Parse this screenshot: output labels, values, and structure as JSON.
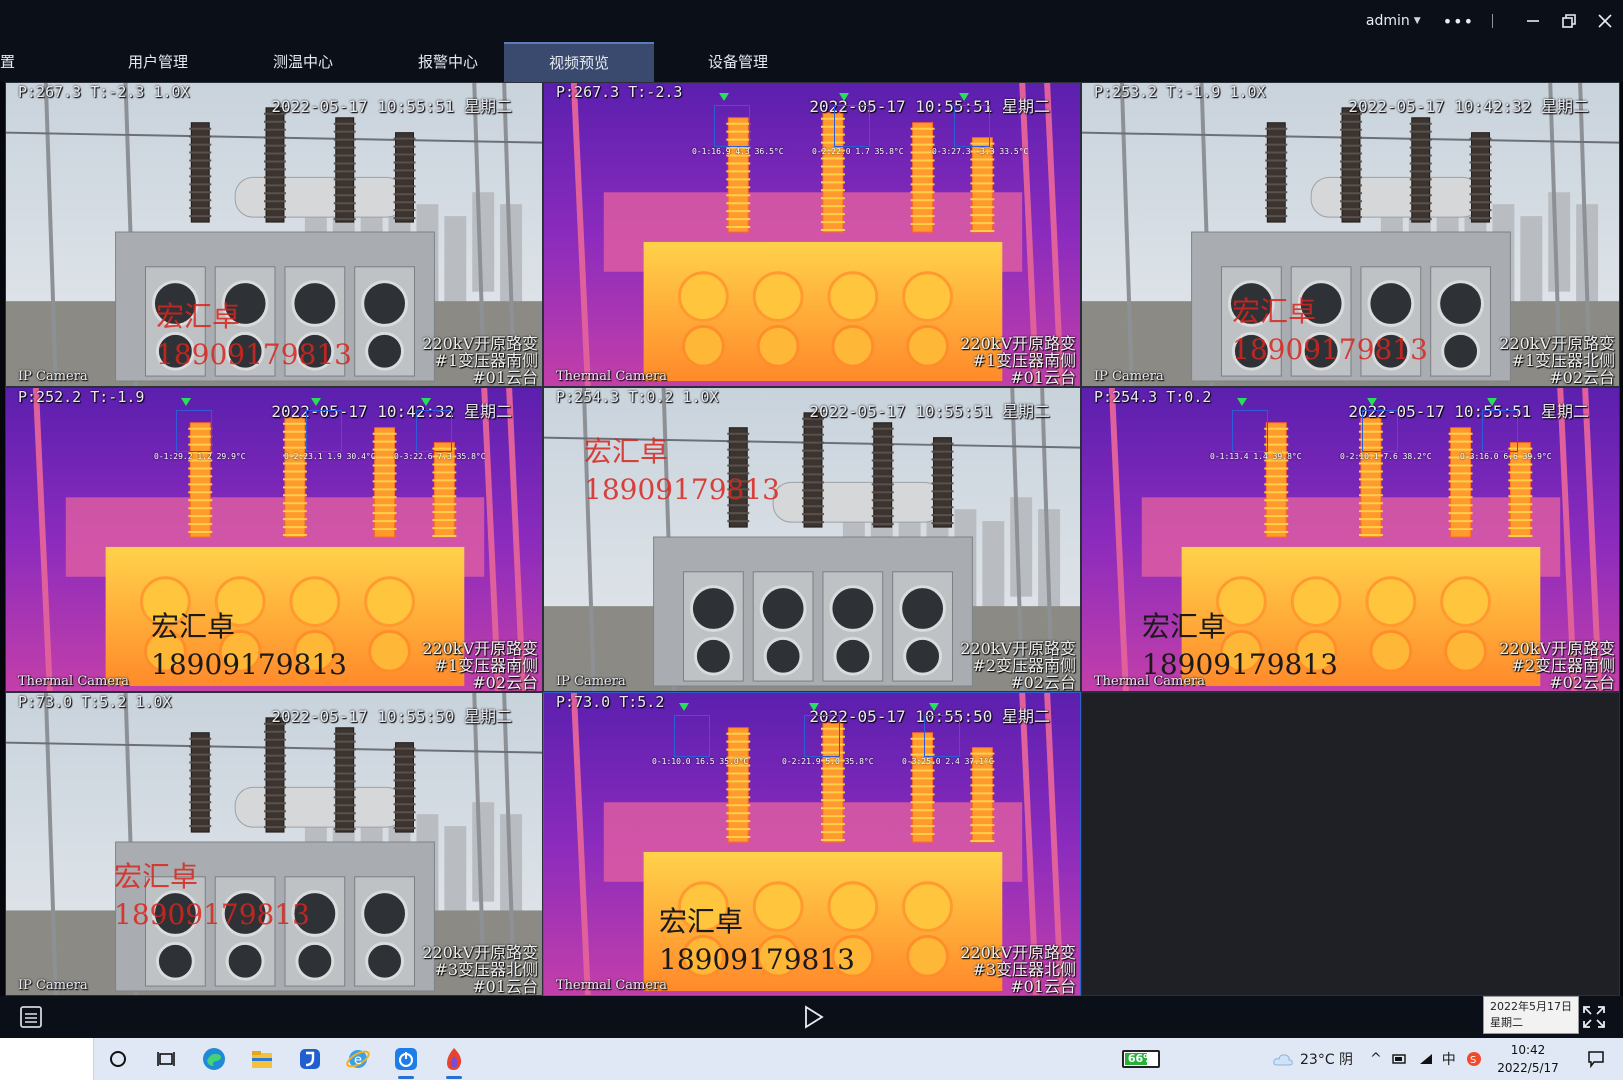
{
  "window": {
    "user": "admin",
    "more_label": "•••",
    "colors": {
      "titlebar": "#0b0f17",
      "active_tab": "#3a4a6e",
      "selected_border": "#2e62c8"
    }
  },
  "nav": {
    "items": [
      {
        "label": "置",
        "active": false
      },
      {
        "label": "用户管理",
        "active": false
      },
      {
        "label": "测温中心",
        "active": false
      },
      {
        "label": "报警中心",
        "active": false
      },
      {
        "label": "视频预览",
        "active": true
      },
      {
        "label": "设备管理",
        "active": false
      }
    ]
  },
  "cells": [
    {
      "type": "visible",
      "ptz": "P:267.3 T:-2.3 1.0X",
      "time": "2022-05-17 10:55:51 星期二",
      "camera": "IP Camera",
      "location": [
        "220kV开原路变",
        "#1变压器南侧",
        "#01云台"
      ],
      "watermark": [
        "宏汇卓",
        "18909179813"
      ],
      "watermark_color": "red"
    },
    {
      "type": "thermal",
      "ptz": "P:267.3 T:-2.3",
      "time": "2022-05-17 10:55:51 星期二",
      "camera": "Thermal Camera",
      "location": [
        "220kV开原路变",
        "#1变压器南侧",
        "#01云台"
      ],
      "rois": [
        "0-1:16.9 4.3 36.5°C",
        "0-2:22.0 1.7 35.8°C",
        "0-3:27.3 -3.3 33.5°C"
      ]
    },
    {
      "type": "visible",
      "ptz": "P:253.2 T:-1.9 1.0X",
      "time": "2022-05-17 10:42:32 星期二",
      "camera": "IP Camera",
      "location": [
        "220kV开原路变",
        "#1变压器北侧",
        "#02云台"
      ],
      "watermark": [
        "宏汇卓",
        "18909179813"
      ],
      "watermark_color": "red"
    },
    {
      "type": "thermal",
      "ptz": "P:252.2 T:-1.9",
      "time": "2022-05-17 10:42:32 星期二",
      "camera": "Thermal Camera",
      "location": [
        "220kV开原路变",
        "#1变压器南侧",
        "#02云台"
      ],
      "rois": [
        "0-1:29.2 1.2 29.9°C",
        "0-2:23.1 1.9 30.4°C",
        "0-3:22.6 7.3 35.8°C"
      ],
      "watermark": [
        "宏汇卓",
        "18909179813"
      ],
      "watermark_color": "dark"
    },
    {
      "type": "visible",
      "ptz": "P:254.3 T:0.2 1.0X",
      "time": "2022-05-17 10:55:51 星期二",
      "camera": "IP Camera",
      "location": [
        "220kV开原路变",
        "#2变压器南侧",
        "#02云台"
      ],
      "watermark": [
        "宏汇卓",
        "18909179813"
      ],
      "watermark_color": "red"
    },
    {
      "type": "thermal",
      "ptz": "P:254.3 T:0.2",
      "time": "2022-05-17 10:55:51 星期二",
      "camera": "Thermal Camera",
      "location": [
        "220kV开原路变",
        "#2变压器南侧",
        "#02云台"
      ],
      "rois": [
        "0-1:13.4 1.4 39.8°C",
        "0-2:10.1 7.6 38.2°C",
        "0-3:16.0 6.6 39.9°C"
      ],
      "watermark": [
        "宏汇卓",
        "18909179813"
      ],
      "watermark_color": "dark"
    },
    {
      "type": "visible",
      "ptz": "P:73.0 T:5.2 1.0X",
      "time": "2022-05-17 10:55:50 星期二",
      "camera": "IP Camera",
      "location": [
        "220kV开原路变",
        "#3变压器北侧",
        "#01云台"
      ],
      "watermark": [
        "宏汇卓",
        "18909179813"
      ],
      "watermark_color": "red"
    },
    {
      "type": "thermal",
      "ptz": "P:73.0 T:5.2",
      "time": "2022-05-17 10:55:50 星期二",
      "camera": "Thermal Camera",
      "location": [
        "220kV开原路变",
        "#3变压器北侧",
        "#01云台"
      ],
      "rois": [
        "0-1:10.0 16.5 35.0°C",
        "0-2:21.9 5.0 35.8°C",
        "0-3:25.0 2.4 37.1°C"
      ],
      "watermark": [
        "宏汇卓",
        "18909179813"
      ],
      "watermark_color": "dark"
    },
    {
      "type": "empty"
    }
  ],
  "controls": {
    "date_tooltip": [
      "2022年5月17日",
      "星期二"
    ]
  },
  "taskbar": {
    "battery_label": "66%",
    "battery_level": 0.66,
    "weather": "23°C 阴",
    "ime": "中",
    "clock_time": "10:42",
    "clock_date": "2022/5/17"
  }
}
